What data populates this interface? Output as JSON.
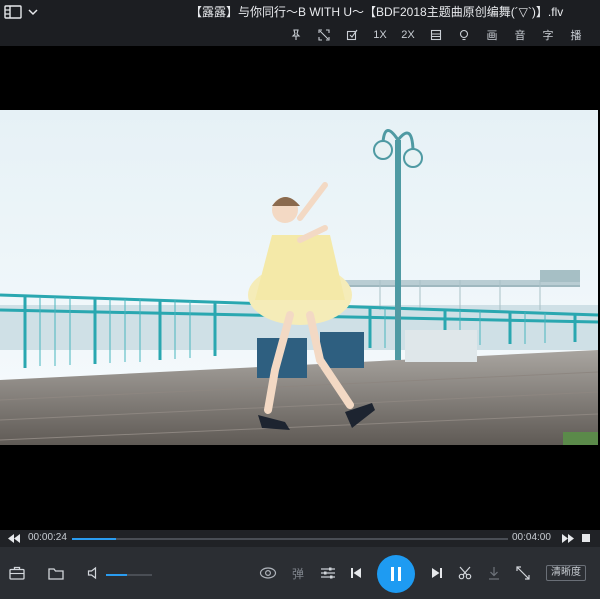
{
  "titlebar": {
    "title": "【露露】与你同行～B WITH U～【BDF2018主题曲原创编舞(´▽`)】.flv"
  },
  "toolbar": {
    "speed_1x": "1X",
    "speed_2x": "2X",
    "audio_label": "音",
    "subtitle_label": "字",
    "playlist_label": "播",
    "picture_label": "画"
  },
  "player": {
    "current_time": "00:00:24",
    "total_time": "00:04:00",
    "progress_fraction": 0.1,
    "volume_fraction": 0.45,
    "danmaku_label": "弹",
    "quality_label": "清晰度"
  },
  "colors": {
    "accent": "#1e9bf2",
    "bar_bg": "#2b2e33",
    "titlebar_bg": "#1c1e22"
  }
}
